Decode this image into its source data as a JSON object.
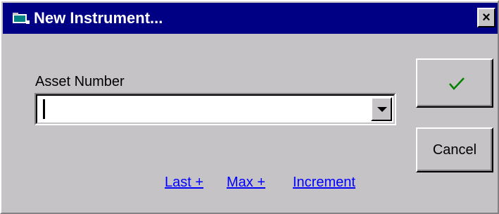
{
  "window": {
    "title": "New Instrument...",
    "title_icon": "instrument-window-icon",
    "close_glyph": "×",
    "close_icon": "close-icon"
  },
  "form": {
    "asset_label": "Asset Number",
    "asset_value": "",
    "dropdown_icon": "chevron-down-icon"
  },
  "buttons": {
    "ok_icon": "checkmark-icon",
    "ok_icon_color": "#008200",
    "cancel_label": "Cancel"
  },
  "links": {
    "last_label": "Last +",
    "max_label": "Max +",
    "increment_label": "Increment",
    "link_color": "#0000ff"
  },
  "colors": {
    "titlebar": "#000084",
    "face": "#c6c3c6"
  }
}
